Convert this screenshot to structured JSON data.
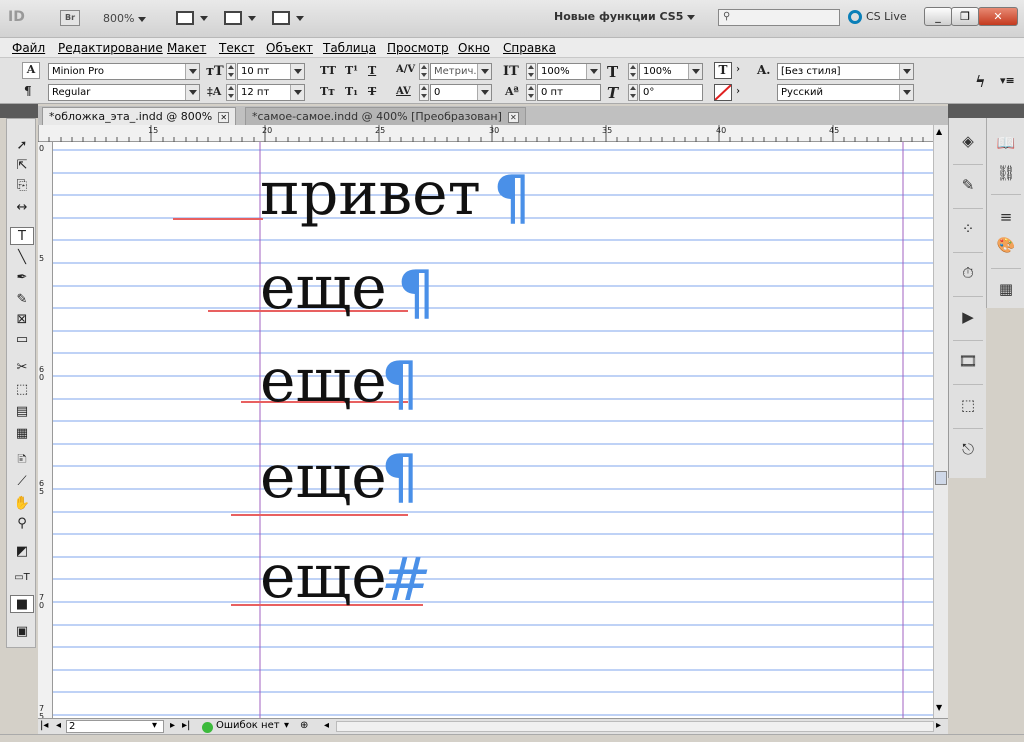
{
  "app": {
    "logo": "ID",
    "bridge": "Br",
    "zoom": "800%",
    "workspace": "Новые функции CS5",
    "search_placeholder": "",
    "cs_live": "CS Live",
    "window_buttons": [
      "_",
      "❐",
      "✕"
    ]
  },
  "menu": [
    "Файл",
    "Редактирование",
    "Макет",
    "Текст",
    "Объект",
    "Таблица",
    "Просмотр",
    "Окно",
    "Справка"
  ],
  "control_panel": {
    "font_family": "Minion Pro",
    "font_style": "Regular",
    "font_size": "10 пт",
    "leading": "12 пт",
    "kerning": "Метрич.",
    "tracking": "0",
    "vertical_scale": "100%",
    "horizontal_scale": "100%",
    "baseline_shift": "0 пт",
    "skew": "0°",
    "char_style": "[Без стиля]",
    "language": "Русский"
  },
  "tabs": [
    {
      "label": "*обложка_эта_.indd @ 800%"
    },
    {
      "label": "*самое-самое.indd @ 400% [Преобразован]"
    }
  ],
  "ruler_top": [
    "15",
    "20",
    "25",
    "30",
    "35",
    "40",
    "45"
  ],
  "ruler_left": [
    "0",
    "5",
    "6 0",
    "6 5",
    "7 0",
    "7 5"
  ],
  "document": {
    "lines": [
      "привет",
      "еще",
      "еще",
      "еще",
      "еще"
    ],
    "end_marks": [
      "¶",
      "¶",
      "¶",
      "¶",
      "#"
    ]
  },
  "status": {
    "page": "2",
    "preflight": "Ошибок нет"
  },
  "colors": {
    "baseline_grid": "#7fa6ee",
    "spelling_underline": "#e86060",
    "hidden_chars": "#4a90e8",
    "margin_guide": "#a060c0"
  }
}
